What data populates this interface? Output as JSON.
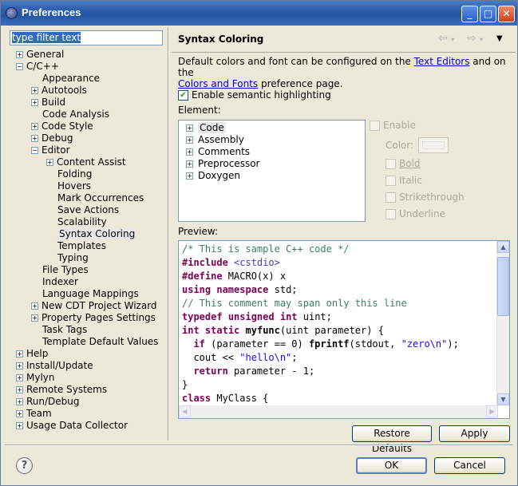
{
  "window": {
    "title": "Preferences",
    "minimize": "0",
    "maximize": "1",
    "close": "r"
  },
  "filter": {
    "text": "type filter text"
  },
  "tree": [
    {
      "label": "General",
      "level": 0,
      "toggle": "+"
    },
    {
      "label": "C/C++",
      "level": 0,
      "toggle": "−"
    },
    {
      "label": "Appearance",
      "level": 1,
      "toggle": ""
    },
    {
      "label": "Autotools",
      "level": 1,
      "toggle": "+"
    },
    {
      "label": "Build",
      "level": 1,
      "toggle": "+"
    },
    {
      "label": "Code Analysis",
      "level": 1,
      "toggle": ""
    },
    {
      "label": "Code Style",
      "level": 1,
      "toggle": "+"
    },
    {
      "label": "Debug",
      "level": 1,
      "toggle": "+"
    },
    {
      "label": "Editor",
      "level": 1,
      "toggle": "−"
    },
    {
      "label": "Content Assist",
      "level": 2,
      "toggle": "+"
    },
    {
      "label": "Folding",
      "level": 2,
      "toggle": ""
    },
    {
      "label": "Hovers",
      "level": 2,
      "toggle": ""
    },
    {
      "label": "Mark Occurrences",
      "level": 2,
      "toggle": ""
    },
    {
      "label": "Save Actions",
      "level": 2,
      "toggle": ""
    },
    {
      "label": "Scalability",
      "level": 2,
      "toggle": ""
    },
    {
      "label": "Syntax Coloring",
      "level": 2,
      "toggle": "",
      "selected": true
    },
    {
      "label": "Templates",
      "level": 2,
      "toggle": ""
    },
    {
      "label": "Typing",
      "level": 2,
      "toggle": ""
    },
    {
      "label": "File Types",
      "level": 1,
      "toggle": ""
    },
    {
      "label": "Indexer",
      "level": 1,
      "toggle": ""
    },
    {
      "label": "Language Mappings",
      "level": 1,
      "toggle": ""
    },
    {
      "label": "New CDT Project Wizard",
      "level": 1,
      "toggle": "+"
    },
    {
      "label": "Property Pages Settings",
      "level": 1,
      "toggle": "+"
    },
    {
      "label": "Task Tags",
      "level": 1,
      "toggle": ""
    },
    {
      "label": "Template Default Values",
      "level": 1,
      "toggle": ""
    },
    {
      "label": "Help",
      "level": 0,
      "toggle": "+"
    },
    {
      "label": "Install/Update",
      "level": 0,
      "toggle": "+"
    },
    {
      "label": "Mylyn",
      "level": 0,
      "toggle": "+"
    },
    {
      "label": "Remote Systems",
      "level": 0,
      "toggle": "+"
    },
    {
      "label": "Run/Debug",
      "level": 0,
      "toggle": "+"
    },
    {
      "label": "Team",
      "level": 0,
      "toggle": "+"
    },
    {
      "label": "Usage Data Collector",
      "level": 0,
      "toggle": "+"
    }
  ],
  "page": {
    "title": "Syntax Coloring",
    "desc_1": "Default colors and font can be configured on the ",
    "desc_link1": "Text Editors",
    "desc_2": " and on the",
    "desc_link2": "Colors and Fonts",
    "desc_3": " preference page.",
    "semantic_label": "Enable semantic highlighting",
    "semantic_checked": "✔",
    "element_label": "Element:",
    "elements": [
      {
        "label": "Code",
        "selected": true
      },
      {
        "label": "Assembly"
      },
      {
        "label": "Comments"
      },
      {
        "label": "Preprocessor"
      },
      {
        "label": "Doxygen"
      }
    ],
    "enable_label": "Enable",
    "color_label": "Color:",
    "bold_label": "Bold",
    "italic_label": "Italic",
    "strike_label": "Strikethrough",
    "underline_label": "Underline",
    "preview_label": "Preview:"
  },
  "buttons": {
    "restore": "Restore Defaults",
    "apply": "Apply",
    "ok": "OK",
    "cancel": "Cancel",
    "help": "?"
  },
  "icons": {
    "back": "⇦",
    "forward": "⇨",
    "menu": "▼"
  }
}
